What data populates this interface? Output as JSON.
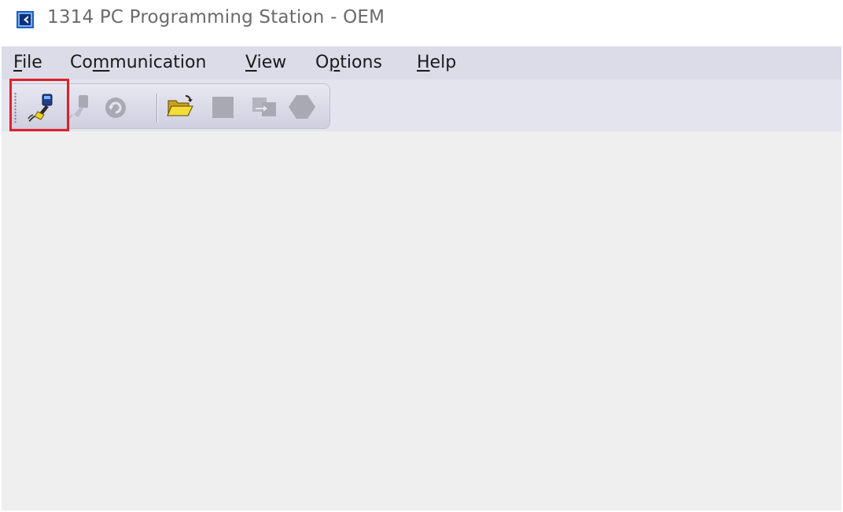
{
  "window": {
    "title": "1314 PC Programming Station - OEM",
    "app_icon": "app-logo-icon"
  },
  "menubar": {
    "items": [
      {
        "label": "File",
        "mnemonic": "F"
      },
      {
        "label": "Communication",
        "mnemonic": "m"
      },
      {
        "label": "View",
        "mnemonic": "V"
      },
      {
        "label": "Options",
        "mnemonic": "p"
      },
      {
        "label": "Help",
        "mnemonic": "H"
      }
    ]
  },
  "toolbar": {
    "buttons": [
      {
        "icon": "connect-icon",
        "enabled": true,
        "highlighted": true
      },
      {
        "icon": "disconnect-icon",
        "enabled": false
      },
      {
        "icon": "refresh-icon",
        "enabled": false
      },
      {
        "icon": "open-folder-icon",
        "enabled": true
      },
      {
        "icon": "stop-icon",
        "enabled": false
      },
      {
        "icon": "transfer-icon",
        "enabled": false
      },
      {
        "icon": "diamond-icon",
        "enabled": false
      }
    ]
  },
  "colors": {
    "menubar_bg": "#dcdce8",
    "client_bg": "#efefef",
    "highlight": "#e0202a",
    "disabled_icon": "#a9a9b4"
  }
}
